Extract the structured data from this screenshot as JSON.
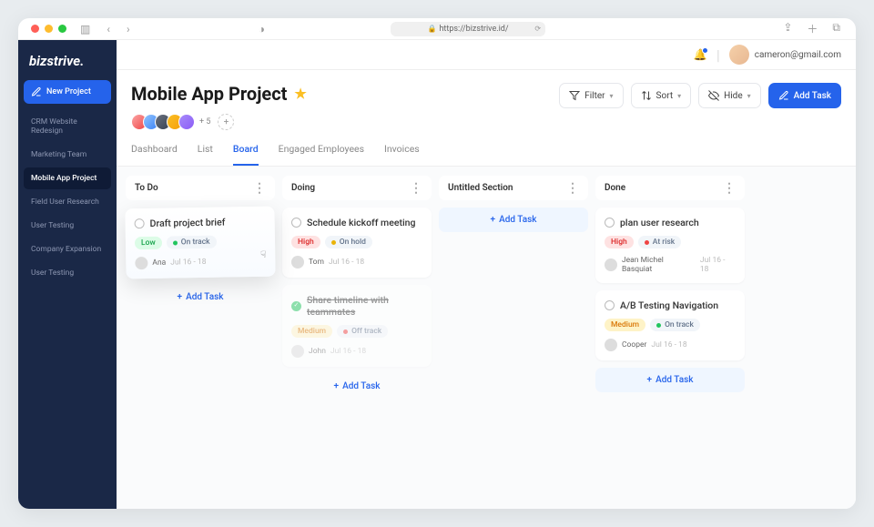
{
  "browser": {
    "url": "https://bizstrive.id/"
  },
  "user": {
    "email": "cameron@gmail.com"
  },
  "sidebar": {
    "logo": "bizstrive.",
    "new_project": "New Project",
    "items": [
      {
        "label": "CRM Website Redesign"
      },
      {
        "label": "Marketing Team"
      },
      {
        "label": "Mobile App Project"
      },
      {
        "label": "Field User Research"
      },
      {
        "label": "User Testing"
      },
      {
        "label": "Company Expansion"
      },
      {
        "label": "User Testing"
      }
    ]
  },
  "project": {
    "title": "Mobile App Project",
    "member_overflow": "+ 5"
  },
  "actions": {
    "filter": "Filter",
    "sort": "Sort",
    "hide": "Hide",
    "add_task": "Add Task"
  },
  "tabs": [
    "Dashboard",
    "List",
    "Board",
    "Engaged Employees",
    "Invoices"
  ],
  "board": {
    "add_task_label": "Add Task",
    "columns": [
      {
        "title": "To Do",
        "cards": [
          {
            "title": "Draft project brief",
            "priority": "Low",
            "priority_class": "low",
            "status": "On track",
            "status_dot": "green",
            "assignee": "Ana",
            "date": "Jul 16 - 18",
            "done": false,
            "lifted": true
          }
        ]
      },
      {
        "title": "Doing",
        "cards": [
          {
            "title": "Schedule kickoff meeting",
            "priority": "High",
            "priority_class": "high",
            "status": "On hold",
            "status_dot": "yellow",
            "assignee": "Tom",
            "date": "Jul 16 - 18",
            "done": false
          },
          {
            "title": "Share timeline with teammates",
            "priority": "Medium",
            "priority_class": "medium",
            "status": "Off track",
            "status_dot": "red",
            "assignee": "John",
            "date": "Jul 16 - 18",
            "done": true,
            "faded": true
          }
        ]
      },
      {
        "title": "Untitled Section",
        "empty": true
      },
      {
        "title": "Done",
        "cards": [
          {
            "title": "plan user research",
            "priority": "High",
            "priority_class": "high",
            "status": "At risk",
            "status_dot": "red",
            "assignee": "Jean Michel Basquiat",
            "date": "Jul 16 - 18",
            "done": false
          },
          {
            "title": "A/B Testing Navigation",
            "priority": "Medium",
            "priority_class": "medium",
            "status": "On track",
            "status_dot": "green",
            "assignee": "Cooper",
            "date": "Jul 16 - 18",
            "done": false
          }
        ]
      }
    ]
  }
}
